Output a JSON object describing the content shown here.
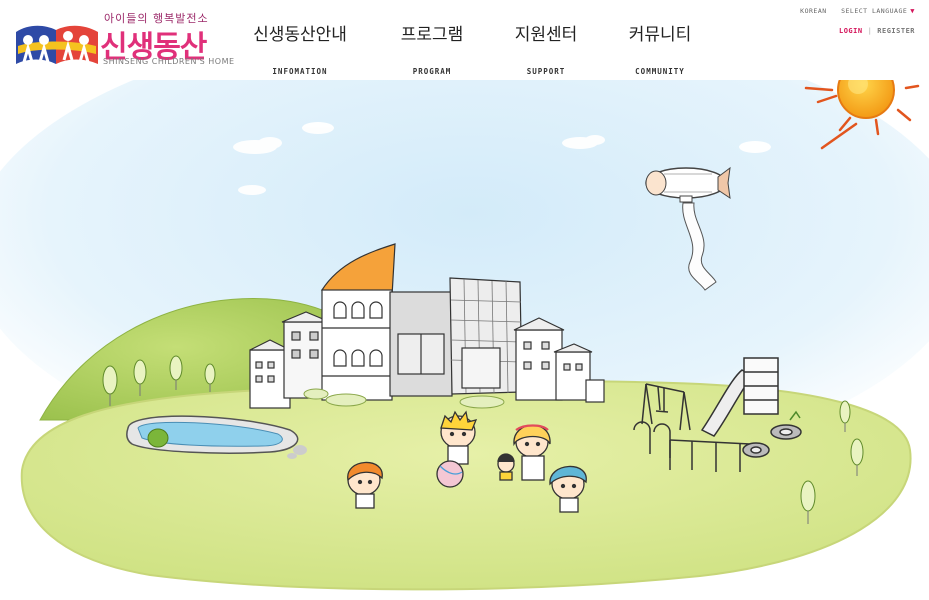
{
  "logo": {
    "tagline": "아이들의 행복발전소",
    "name": "신생동산",
    "subtitle": "SHINSENG CHILDREN'S HOME"
  },
  "nav": [
    {
      "label": "신생동산안내",
      "sub": "INFOMATION"
    },
    {
      "label": "프로그램",
      "sub": "PROGRAM"
    },
    {
      "label": "지원센터",
      "sub": "SUPPORT"
    },
    {
      "label": "커뮤니티",
      "sub": "COMMUNITY"
    }
  ],
  "utility": {
    "language": "KOREAN",
    "select_language": "SELECT LANGUAGE",
    "login": "LOGIN",
    "register": "REGISTER"
  },
  "colors": {
    "brand_pink": "#e0307a",
    "accent_red": "#d4145a",
    "grass": "#dcea94",
    "sky": "#d6ecfa",
    "sun": "#f7a21b"
  }
}
